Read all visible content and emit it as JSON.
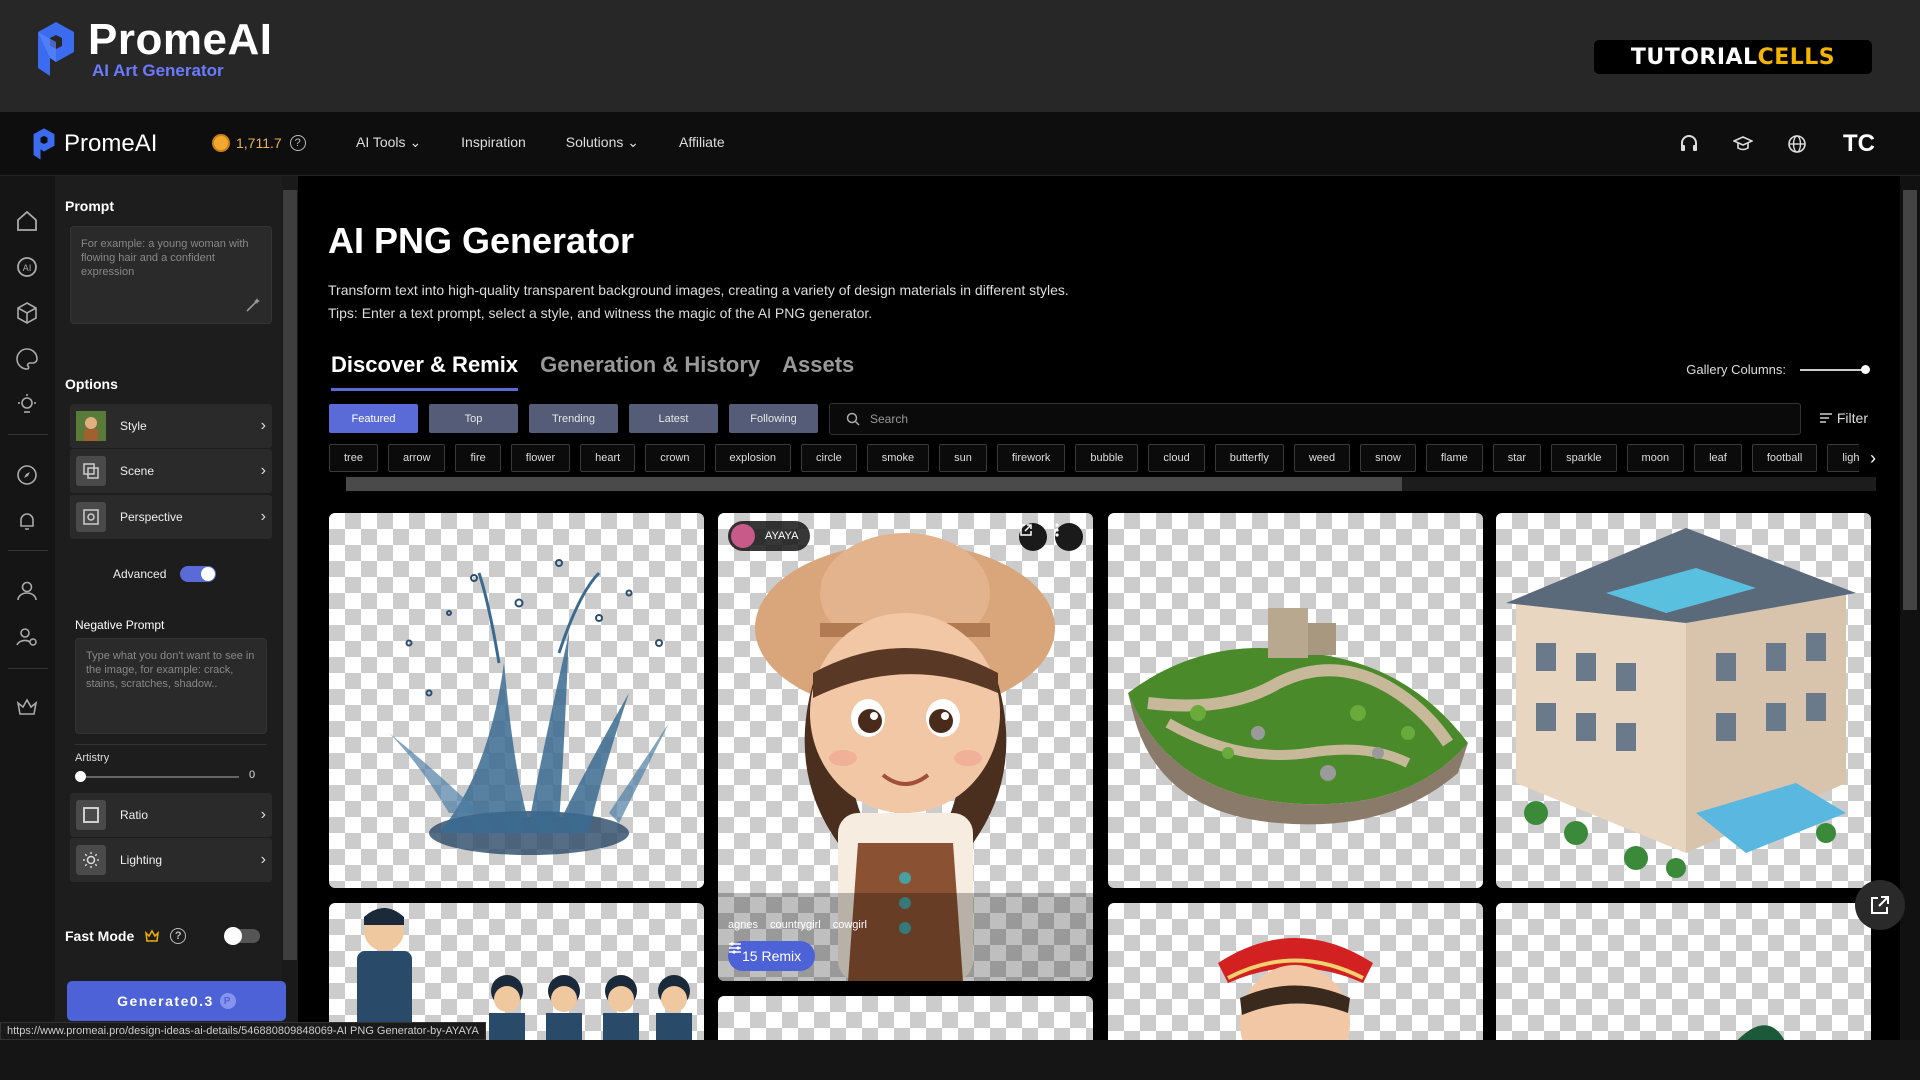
{
  "brand": {
    "name": "PromeAI",
    "subtitle": "AI Art Generator"
  },
  "watermark": {
    "part1": "TUTORIAL",
    "part2": "CELLS"
  },
  "nav": {
    "logo": "PromeAI",
    "credits": "1,711.7",
    "links": [
      "AI Tools",
      "Inspiration",
      "Solutions",
      "Affiliate"
    ],
    "avatar": "TC"
  },
  "panel": {
    "prompt_title": "Prompt",
    "prompt_placeholder": "For example: a young woman with flowing hair and a confident expression",
    "options_title": "Options",
    "style": "Style",
    "scene": "Scene",
    "perspective": "Perspective",
    "advanced": "Advanced",
    "negative_title": "Negative Prompt",
    "negative_placeholder": "Type what you don't want to see in the image, for example: crack, stains, scratches, shadow..",
    "artistry": "Artistry",
    "artistry_value": "0",
    "ratio": "Ratio",
    "lighting": "Lighting",
    "fast_mode": "Fast Mode",
    "generate": "Generate0.3"
  },
  "main": {
    "title": "AI PNG Generator",
    "desc1": "Transform text into high-quality transparent background images, creating a variety of design materials in different styles.",
    "desc2": "Tips: Enter a text prompt, select a style, and witness the magic of the AI PNG generator.",
    "tabs": [
      "Discover & Remix",
      "Generation & History",
      "Assets"
    ],
    "gallery_columns": "Gallery Columns:",
    "filters": [
      "Featured",
      "Top",
      "Trending",
      "Latest",
      "Following"
    ],
    "search_placeholder": "Search",
    "filter_label": "Filter",
    "tags": [
      "tree",
      "arrow",
      "fire",
      "flower",
      "heart",
      "crown",
      "explosion",
      "circle",
      "smoke",
      "sun",
      "firework",
      "bubble",
      "cloud",
      "butterfly",
      "weed",
      "snow",
      "flame",
      "star",
      "sparkle",
      "moon",
      "leaf",
      "football",
      "light"
    ]
  },
  "featured_card": {
    "user": "AYAYA",
    "tags": [
      "agnes",
      "countrygirl",
      "cowgirl"
    ],
    "remix": "15 Remix"
  },
  "status_url": "https://www.promeai.pro/design-ideas-ai-details/546880809848069-AI PNG Generator-by-AYAYA"
}
